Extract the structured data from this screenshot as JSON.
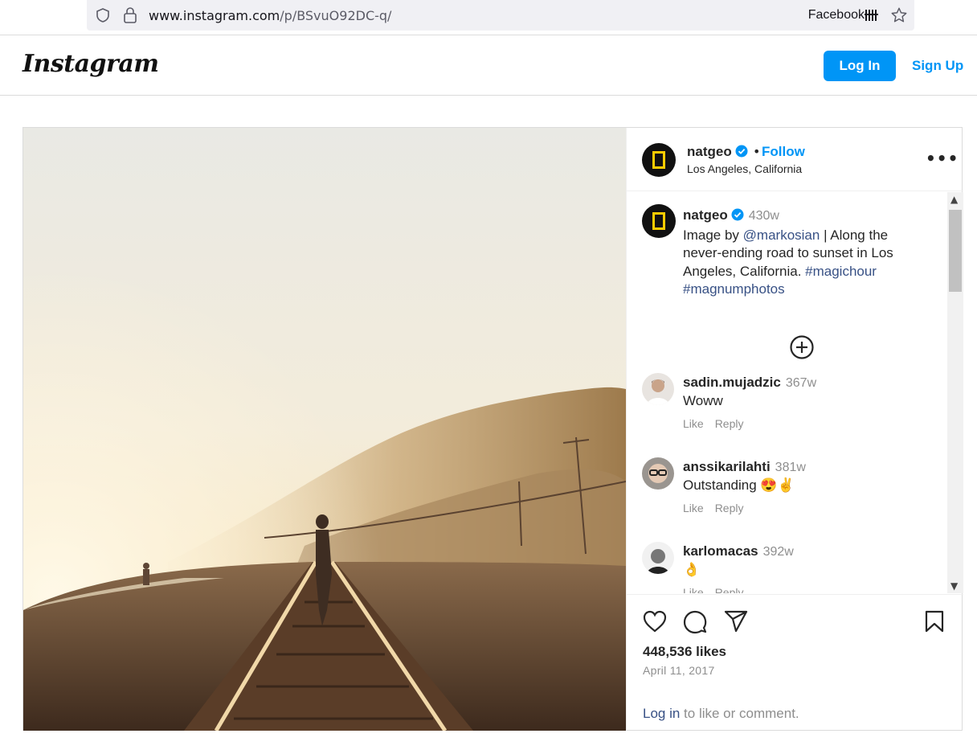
{
  "browser": {
    "url_host": "www.instagram.com",
    "url_path": "/p/BSvuO92DC-q/",
    "container_label": "Facebook"
  },
  "header": {
    "logo": "Instagram",
    "login_label": "Log In",
    "signup_label": "Sign Up"
  },
  "post": {
    "username": "natgeo",
    "follow_label": "Follow",
    "separator": "•",
    "location": "Los Angeles, California",
    "caption": {
      "username": "natgeo",
      "time": "430w",
      "text_1": "Image by ",
      "mention": "@markosian",
      "text_2": " | Along the never-ending road to sunset in Los Angeles, California. ",
      "hashtag_1": "#magichour",
      "hashtag_2": "#magnumphotos"
    },
    "comments": [
      {
        "username": "sadin.mujadzic",
        "time": "367w",
        "text": "Woww",
        "like": "Like",
        "reply": "Reply"
      },
      {
        "username": "anssikarilahti",
        "time": "381w",
        "text": "Outstanding 😍✌",
        "like": "Like",
        "reply": "Reply"
      },
      {
        "username": "karlomacas",
        "time": "392w",
        "text": "👌",
        "like": "Like",
        "reply": "Reply"
      }
    ],
    "likes": "448,536 likes",
    "date": "April 11, 2017",
    "login_link": "Log in",
    "login_suffix": " to like or comment."
  },
  "colors": {
    "accent": "#0095f6",
    "link": "#385185",
    "muted": "#8e8e8e",
    "natgeo_yellow": "#ffcc00"
  }
}
